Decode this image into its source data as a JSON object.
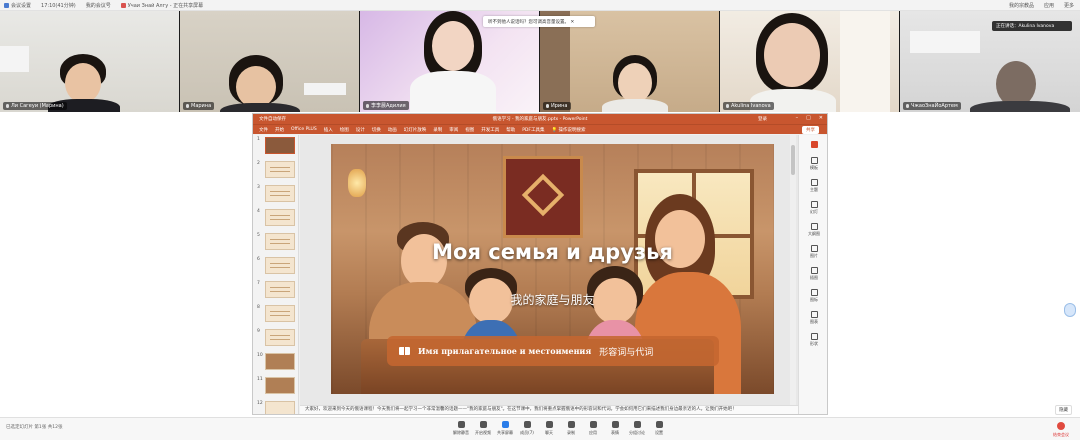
{
  "topbar": {
    "left": [
      "会议设置",
      "17:10(41分钟)",
      "我的会议号",
      "Учаи Знай Алгу - 正在共享屏幕"
    ],
    "right": [
      "我的宗教品",
      "应用",
      "更多"
    ]
  },
  "participants": [
    {
      "name": "Ли Сагеуи (Марина)",
      "active": false
    },
    {
      "name": "Марина",
      "active": false
    },
    {
      "name": "李李晨Адилия",
      "active": false
    },
    {
      "name": "Ирина",
      "active": false
    },
    {
      "name": "Akulina Ivanova",
      "active": true
    },
    {
      "name": "ЧжаоЗнаЙоАртем",
      "active": false
    }
  ],
  "toast": {
    "text": "听不到他人说话吗？您可调高音量设置。"
  },
  "speaker_chip": {
    "text": "正在讲话：Akulina Ivanova"
  },
  "ppt": {
    "title": "俄语学习 - 我的家庭与朋友.pptx - PowerPoint",
    "user": "登录",
    "quick_access": "文件自动保存",
    "ribbon": [
      "文件",
      "开始",
      "Office PLUS",
      "插入",
      "绘图",
      "设计",
      "切换",
      "动画",
      "幻灯片放映",
      "录制",
      "审阅",
      "视图",
      "开发工具",
      "帮助",
      "PDF工具集",
      "操作说明搜索"
    ],
    "share": "共享",
    "slide_numbers": [
      "1",
      "2",
      "3",
      "4",
      "5",
      "6",
      "7",
      "8",
      "9",
      "10",
      "11",
      "12"
    ],
    "slide": {
      "title": "Моя семья и друзья",
      "subtitle": "我的家庭与朋友",
      "banner_ru": "Имя прилагательное и местоимения",
      "banner_cn": "形容词与代词"
    },
    "notes": "大家好，欢迎来到今天的俄语课程！今天我们将一起学习一个非常温馨的话题——\"我的家庭与朋友\"。在这节课中，我们将重点掌握俄语中的形容词和代词。学会如何用它们来描述我们身边最亲近的人。让我们开始吧！",
    "right_panel": [
      "模板",
      "主题",
      "幻灯",
      "大纲图",
      "图片",
      "插图",
      "图标",
      "图表",
      "形状"
    ]
  },
  "bottombar": {
    "left": "已选定幻灯片  第1张 共12张",
    "items": [
      "解除静音",
      "开启视频",
      "共享屏幕",
      "成员(7)",
      "聊天",
      "录制",
      "应用",
      "表情",
      "分组讨论",
      "设置"
    ],
    "end": "结束会议"
  },
  "float_button": "隐藏"
}
